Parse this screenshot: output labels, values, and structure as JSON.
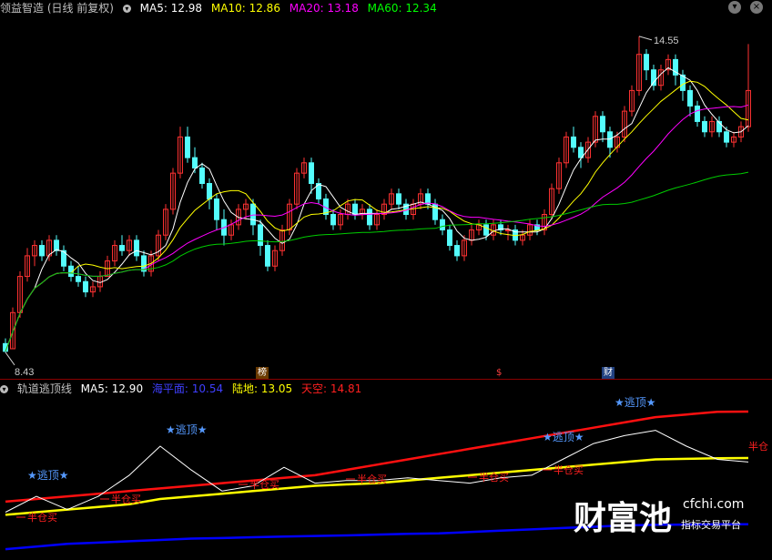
{
  "header": {
    "title": "领益智造 (日线 前复权)",
    "ma5": "MA5: 12.98",
    "ma10": "MA10: 12.86",
    "ma20": "MA20: 13.18",
    "ma60": "MA60: 12.34"
  },
  "subheader": {
    "name": "轨道逃顶线",
    "ma5": "MA5: 12.90",
    "sea": "海平面: 10.54",
    "land": "陆地: 13.05",
    "sky": "天空: 14.81"
  },
  "annotations": {
    "high": "14.55",
    "low": "8.43",
    "tag1": "榜",
    "tag2": "$",
    "tag3": "财",
    "escape": "★逃顶★",
    "half": "半仓买",
    "edge": "半仓"
  },
  "watermark": {
    "logo": "财富池",
    "domain": "cfchi.com",
    "slogan": "指标交易平台"
  },
  "colors": {
    "up": "#ff3232",
    "down": "#54fcfc",
    "ma5": "#ffffff",
    "ma10": "#ffff00",
    "ma20": "#ff00ff",
    "ma60": "#00cc00",
    "sky": "#ff1010",
    "land": "#ffff00",
    "sea": "#0000ff",
    "escape": "#5599ff",
    "buy": "#ff2020"
  },
  "chart_data": [
    {
      "type": "candlestick",
      "title": "领益智造 (日线 前复权)",
      "ylim": [
        8.2,
        14.9
      ],
      "min_price": 8.43,
      "max_price": 14.55,
      "candles": [
        [
          8.6,
          8.45,
          8.7,
          8.43
        ],
        [
          8.5,
          9.2,
          9.3,
          8.5
        ],
        [
          9.2,
          9.9,
          10.0,
          9.1
        ],
        [
          9.9,
          10.3,
          10.45,
          9.8
        ],
        [
          10.3,
          10.5,
          10.6,
          10.1
        ],
        [
          10.5,
          10.3,
          10.6,
          10.2
        ],
        [
          10.3,
          10.6,
          10.7,
          10.2
        ],
        [
          10.6,
          10.4,
          10.7,
          10.3
        ],
        [
          10.4,
          10.1,
          10.5,
          10.0
        ],
        [
          10.1,
          9.9,
          10.2,
          9.8
        ],
        [
          9.9,
          9.8,
          10.1,
          9.7
        ],
        [
          9.8,
          9.6,
          9.9,
          9.5
        ],
        [
          9.6,
          9.7,
          9.8,
          9.5
        ],
        [
          9.7,
          9.9,
          10.0,
          9.6
        ],
        [
          9.9,
          10.2,
          10.3,
          9.9
        ],
        [
          10.2,
          10.5,
          10.6,
          10.1
        ],
        [
          10.5,
          10.4,
          10.7,
          10.3
        ],
        [
          10.4,
          10.6,
          10.7,
          10.3
        ],
        [
          10.6,
          10.3,
          10.7,
          10.2
        ],
        [
          10.3,
          10.0,
          10.4,
          9.9
        ],
        [
          10.0,
          10.3,
          10.4,
          9.9
        ],
        [
          10.3,
          10.7,
          10.8,
          10.2
        ],
        [
          10.7,
          11.2,
          11.3,
          10.6
        ],
        [
          11.2,
          11.9,
          12.0,
          11.1
        ],
        [
          11.9,
          12.6,
          12.8,
          11.8
        ],
        [
          12.6,
          12.2,
          12.8,
          12.1
        ],
        [
          12.2,
          12.0,
          12.4,
          11.9
        ],
        [
          12.0,
          11.7,
          12.1,
          11.6
        ],
        [
          11.7,
          11.4,
          11.8,
          11.2
        ],
        [
          11.4,
          11.0,
          11.5,
          10.8
        ],
        [
          11.0,
          10.7,
          11.2,
          10.5
        ],
        [
          10.7,
          10.9,
          11.0,
          10.6
        ],
        [
          10.9,
          11.2,
          11.3,
          10.8
        ],
        [
          11.2,
          11.3,
          11.4,
          11.0
        ],
        [
          11.3,
          10.9,
          11.4,
          10.7
        ],
        [
          10.9,
          10.5,
          11.0,
          10.3
        ],
        [
          10.5,
          10.1,
          10.6,
          10.0
        ],
        [
          10.1,
          10.4,
          10.5,
          10.0
        ],
        [
          10.4,
          10.8,
          10.9,
          10.3
        ],
        [
          10.8,
          11.3,
          11.4,
          10.7
        ],
        [
          11.3,
          11.9,
          12.0,
          11.2
        ],
        [
          11.9,
          12.1,
          12.2,
          11.8
        ],
        [
          12.1,
          11.7,
          12.2,
          11.5
        ],
        [
          11.7,
          11.4,
          11.8,
          11.3
        ],
        [
          11.4,
          11.1,
          11.5,
          11.0
        ],
        [
          11.1,
          10.9,
          11.2,
          10.8
        ],
        [
          10.9,
          11.1,
          11.2,
          10.8
        ],
        [
          11.1,
          11.3,
          11.4,
          11.0
        ],
        [
          11.3,
          11.1,
          11.4,
          11.0
        ],
        [
          11.1,
          11.2,
          11.3,
          11.0
        ],
        [
          11.2,
          10.9,
          11.3,
          10.8
        ],
        [
          10.9,
          11.1,
          11.2,
          10.8
        ],
        [
          11.1,
          11.3,
          11.4,
          11.0
        ],
        [
          11.3,
          11.5,
          11.6,
          11.2
        ],
        [
          11.5,
          11.3,
          11.6,
          11.2
        ],
        [
          11.3,
          11.1,
          11.4,
          11.0
        ],
        [
          11.1,
          11.3,
          11.4,
          11.0
        ],
        [
          11.3,
          11.5,
          11.6,
          11.2
        ],
        [
          11.5,
          11.3,
          11.6,
          11.2
        ],
        [
          11.3,
          11.0,
          11.4,
          10.9
        ],
        [
          11.0,
          10.8,
          11.1,
          10.7
        ],
        [
          10.8,
          10.5,
          10.9,
          10.4
        ],
        [
          10.5,
          10.3,
          10.6,
          10.2
        ],
        [
          10.3,
          10.6,
          10.7,
          10.2
        ],
        [
          10.6,
          10.8,
          10.9,
          10.5
        ],
        [
          10.8,
          10.9,
          11.0,
          10.7
        ],
        [
          10.9,
          10.7,
          11.0,
          10.6
        ],
        [
          10.7,
          10.9,
          11.0,
          10.6
        ],
        [
          10.9,
          10.8,
          11.0,
          10.7
        ],
        [
          10.8,
          10.8,
          10.9,
          10.6
        ],
        [
          10.8,
          10.6,
          10.9,
          10.5
        ],
        [
          10.6,
          10.7,
          10.8,
          10.5
        ],
        [
          10.7,
          10.9,
          11.0,
          10.6
        ],
        [
          10.9,
          10.8,
          11.0,
          10.7
        ],
        [
          10.8,
          11.1,
          11.2,
          10.7
        ],
        [
          11.1,
          11.6,
          11.7,
          11.0
        ],
        [
          11.6,
          12.1,
          12.2,
          11.5
        ],
        [
          12.1,
          12.6,
          12.7,
          12.0
        ],
        [
          12.6,
          12.4,
          12.8,
          12.3
        ],
        [
          12.4,
          12.2,
          12.5,
          12.0
        ],
        [
          12.2,
          12.5,
          12.6,
          12.1
        ],
        [
          12.5,
          13.0,
          13.1,
          12.4
        ],
        [
          13.0,
          12.7,
          13.1,
          12.5
        ],
        [
          12.7,
          12.4,
          12.8,
          12.2
        ],
        [
          12.4,
          12.6,
          12.7,
          12.3
        ],
        [
          12.6,
          13.1,
          13.2,
          12.5
        ],
        [
          13.1,
          13.5,
          13.6,
          13.0
        ],
        [
          13.5,
          14.2,
          14.55,
          13.4
        ],
        [
          14.2,
          13.9,
          14.3,
          13.7
        ],
        [
          13.9,
          13.6,
          14.0,
          13.5
        ],
        [
          13.6,
          13.9,
          14.0,
          13.5
        ],
        [
          13.9,
          14.1,
          14.2,
          13.8
        ],
        [
          14.1,
          13.8,
          14.2,
          13.6
        ],
        [
          13.8,
          13.5,
          13.9,
          13.3
        ],
        [
          13.5,
          13.2,
          13.6,
          13.0
        ],
        [
          13.2,
          12.9,
          13.3,
          12.8
        ],
        [
          12.9,
          12.7,
          13.0,
          12.6
        ],
        [
          12.7,
          12.9,
          13.0,
          12.6
        ],
        [
          12.9,
          12.7,
          13.0,
          12.6
        ],
        [
          12.7,
          12.5,
          12.8,
          12.4
        ],
        [
          12.5,
          12.6,
          12.7,
          12.4
        ],
        [
          12.6,
          12.8,
          12.9,
          12.5
        ],
        [
          12.8,
          13.5,
          14.4,
          12.7
        ]
      ],
      "series_names": [
        "MA5",
        "MA10",
        "MA20",
        "MA60"
      ]
    },
    {
      "type": "line",
      "title": "轨道逃顶线",
      "ylim": [
        9.5,
        15.5
      ],
      "series": [
        {
          "name": "天空",
          "values": [
            11.4,
            11.5,
            11.6,
            11.7,
            11.8,
            11.9,
            12.0,
            12.1,
            12.2,
            12.3,
            12.4,
            12.6,
            12.8,
            13.0,
            13.2,
            13.4,
            13.6,
            13.8,
            14.0,
            14.2,
            14.4,
            14.6,
            14.7,
            14.8,
            14.81
          ]
        },
        {
          "name": "陆地",
          "values": [
            10.9,
            11.0,
            11.1,
            11.2,
            11.3,
            11.5,
            11.6,
            11.7,
            11.8,
            11.9,
            12.0,
            12.05,
            12.1,
            12.2,
            12.3,
            12.4,
            12.5,
            12.6,
            12.7,
            12.8,
            12.9,
            13.0,
            13.02,
            13.04,
            13.05
          ]
        },
        {
          "name": "海平面",
          "values": [
            9.6,
            9.7,
            9.8,
            9.85,
            9.9,
            9.95,
            10.0,
            10.02,
            10.05,
            10.08,
            10.1,
            10.12,
            10.15,
            10.18,
            10.2,
            10.25,
            10.3,
            10.35,
            10.4,
            10.45,
            10.5,
            10.52,
            10.53,
            10.54,
            10.54
          ]
        },
        {
          "name": "MA5",
          "values": [
            11.0,
            11.6,
            11.1,
            11.6,
            12.4,
            13.5,
            12.6,
            11.8,
            12.0,
            12.7,
            12.1,
            12.2,
            12.2,
            12.3,
            12.2,
            12.1,
            12.3,
            12.4,
            13.0,
            13.6,
            13.9,
            14.1,
            13.5,
            13.0,
            12.9
          ]
        }
      ]
    }
  ]
}
